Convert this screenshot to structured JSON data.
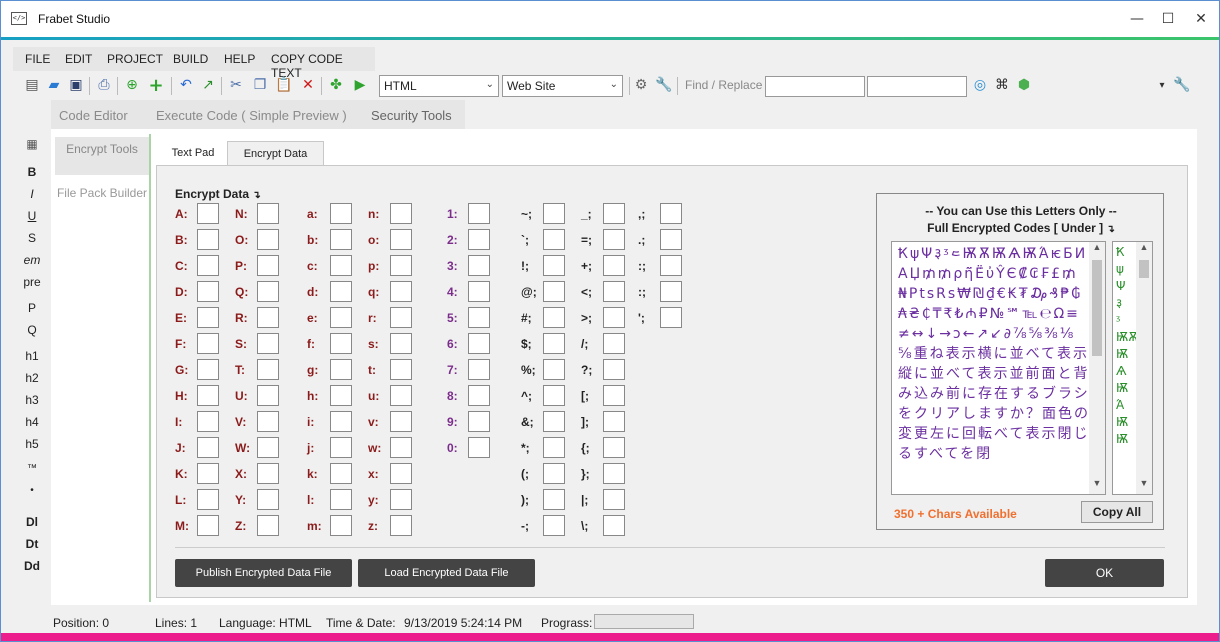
{
  "window": {
    "title": "Frabet Studio",
    "icon": "code-window-icon",
    "icon_text": "</>"
  },
  "menu": [
    "FILE",
    "EDIT",
    "PROJECT",
    "BUILD",
    "HELP",
    "COPY CODE TEXT"
  ],
  "toolbar": {
    "language_select": "HTML",
    "project_select": "Web Site",
    "find_label": "Find / Replace",
    "find_value": "",
    "replace_value": ""
  },
  "left_tools": [
    "B",
    "I",
    "U",
    "S",
    "em",
    "pre",
    "P",
    "Q",
    "h1",
    "h2",
    "h3",
    "h4",
    "h5",
    "™",
    "•",
    "Dl",
    "Dt",
    "Dd"
  ],
  "editor_tabs": [
    "Code Editor",
    "Execute Code ( Simple Preview )",
    "Security Tools"
  ],
  "side": {
    "encrypt": "Encrypt Tools",
    "filepack": "File Pack Builder"
  },
  "sub_tabs": [
    "Text Pad",
    "Encrypt Data"
  ],
  "encrypt": {
    "heading": "Encrypt Data",
    "heading_icon": "return-arrow-icon",
    "col1": [
      "A:",
      "B:",
      "C:",
      "D:",
      "E:",
      "F:",
      "G:",
      "H:",
      "I:",
      "J:",
      "K:",
      "L:",
      "M:"
    ],
    "col2": [
      "N:",
      "O:",
      "P:",
      "Q:",
      "R:",
      "S:",
      "T:",
      "U:",
      "V:",
      "W:",
      "X:",
      "Y:",
      "Z:"
    ],
    "col3": [
      "a:",
      "b:",
      "c:",
      "d:",
      "e:",
      "f:",
      "g:",
      "h:",
      "i:",
      "j:",
      "k:",
      "l:",
      "m:"
    ],
    "col4": [
      "n:",
      "o:",
      "p:",
      "q:",
      "r:",
      "s:",
      "t:",
      "u:",
      "v:",
      "w:",
      "x:",
      "y:",
      "z:"
    ],
    "col5": [
      "1:",
      "2:",
      "3:",
      "4:",
      "5:",
      "6:",
      "7:",
      "8:",
      "9:",
      "0:"
    ],
    "col6": [
      "~;",
      "`;",
      "!;",
      "@;",
      "#;",
      "$;",
      "%;",
      "^;",
      "&;",
      "*;",
      "(;",
      ");",
      "-;"
    ],
    "col7": [
      "_;",
      "=;",
      "+;",
      "<;",
      ">;",
      "/;",
      "?;",
      "[;",
      "];",
      "{;",
      "};",
      "|;",
      "\\;"
    ],
    "col8": [
      ",;",
      ".;",
      ":;",
      ":;",
      "';"
    ]
  },
  "info": {
    "line1": "-- You can Use this Letters Only --",
    "line2": "Full Encrypted Codes [ Under ]",
    "chars": "ҞψΨ३ᶾ᱄ѬѪѬѦѬΆѥБИАЏ₥₥ρῆ̈Ё̇ὐŶЄ₡₢₣£₥₦PtsRs₩₪₫€₭₮₯₰₱₲₳₴₵₸₹₺₼₽№℠℡℮Ω≡≠↔↓→ↄ←↗↙∂⅞⅝⅜⅛⅝重ね表示横に並べて表示縦に並べて表示並前面と背み込み前に存在するブラシをクリアしますか？面色の変更左に回転べて表示閉じるすべてを閉",
    "available": "350 + Chars Available",
    "copy_all": "Copy All",
    "list": [
      "Ҟ",
      "ψ",
      "Ψ",
      "३",
      "ᶾ",
      "ѬѪ",
      "Ѭ",
      "Ѧ",
      "Ѭ",
      "Ά",
      "Ѭ",
      "Ѭ"
    ]
  },
  "buttons": {
    "publish": "Publish Encrypted Data File",
    "load": "Load Encrypted Data File",
    "ok": "OK"
  },
  "status": {
    "position": "Position: 0",
    "lines": "Lines: 1",
    "language": "Language: HTML",
    "time_label": "Time & Date:",
    "time_value": "9/13/2019 5:24:14 PM",
    "progress_label": "Prograss:",
    "progress": 0
  },
  "colors": {
    "accent_top": "#18a0c4",
    "accent_bottom": "#ec1c8c",
    "label_red": "#8b1a1a",
    "label_purple": "#7b2d8b",
    "chars_purple": "#6b2fa0",
    "available_orange": "#f07030"
  }
}
